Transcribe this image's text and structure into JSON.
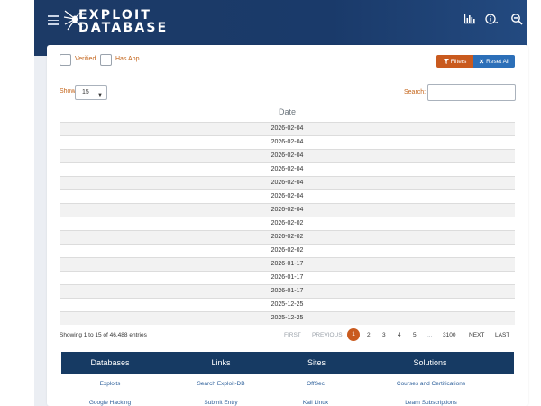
{
  "brand": {
    "line1": "EXPLOIT",
    "line2": "DATABASE"
  },
  "nav_icons": [
    "stats-icon",
    "info-icon",
    "search-exploit-icon"
  ],
  "filters": {
    "verified_label": "Verified",
    "has_app_label": "Has App",
    "filters_button": "Filters",
    "reset_button": "Reset All"
  },
  "table_controls": {
    "show_label": "Show",
    "show_value": "15",
    "search_label": "Search:",
    "search_value": ""
  },
  "table": {
    "column_header": "Date",
    "rows": [
      "2026-02-04",
      "2026-02-04",
      "2026-02-04",
      "2026-02-04",
      "2026-02-04",
      "2026-02-04",
      "2026-02-04",
      "2026-02-02",
      "2026-02-02",
      "2026-02-02",
      "2026-01-17",
      "2026-01-17",
      "2026-01-17",
      "2025-12-25",
      "2025-12-25"
    ]
  },
  "entries_info": "Showing 1 to 15 of 46,488 entries",
  "pagination": {
    "first": "FIRST",
    "previous": "PREVIOUS",
    "current": "1",
    "pages": [
      "2",
      "3",
      "4",
      "5"
    ],
    "ellipsis": "...",
    "last_page": "3100",
    "next": "NEXT",
    "last": "LAST"
  },
  "footer": {
    "headings": [
      "Databases",
      "Links",
      "Sites",
      "Solutions"
    ],
    "row1": [
      "Exploits",
      "Search Exploit-DB",
      "OffSec",
      "Courses and Certifications"
    ],
    "row2": [
      "Google Hacking",
      "Submit Entry",
      "Kali Linux",
      "Learn Subscriptions"
    ]
  },
  "colors": {
    "header_blue": "#1c3a66",
    "accent_orange": "#c95a1e",
    "reset_blue": "#2c6fb8",
    "footer_navy": "#163a63"
  }
}
